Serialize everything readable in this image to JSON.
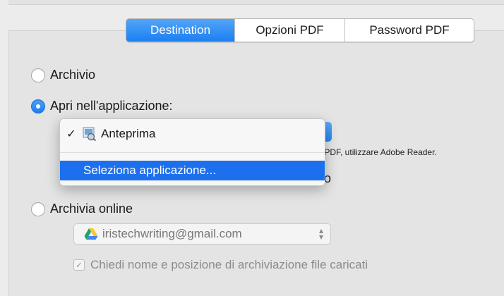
{
  "tabs": [
    {
      "label": "Destination",
      "active": true
    },
    {
      "label": "Opzioni PDF",
      "active": false
    },
    {
      "label": "Password PDF",
      "active": false
    }
  ],
  "options": {
    "archivio": "Archivio",
    "apri": "Apri nell'applicazione:",
    "online": "Archivia online"
  },
  "app_menu": {
    "checked_item": "Anteprima",
    "check_mark": "✓",
    "select_item": "Seleziona applicazione...",
    "highlight_color": "#1d70ed"
  },
  "background_text": {
    "note": "to PDF, utilizzare Adobe Reader.",
    "trailing": "ivio"
  },
  "online": {
    "account": "iristechwriting@gmail.com",
    "ask_label": "Chiedi nome e posizione di archiviazione file caricati",
    "ask_checked": true
  },
  "colors": {
    "accent": "#1b7ff2",
    "background": "#ececec"
  }
}
